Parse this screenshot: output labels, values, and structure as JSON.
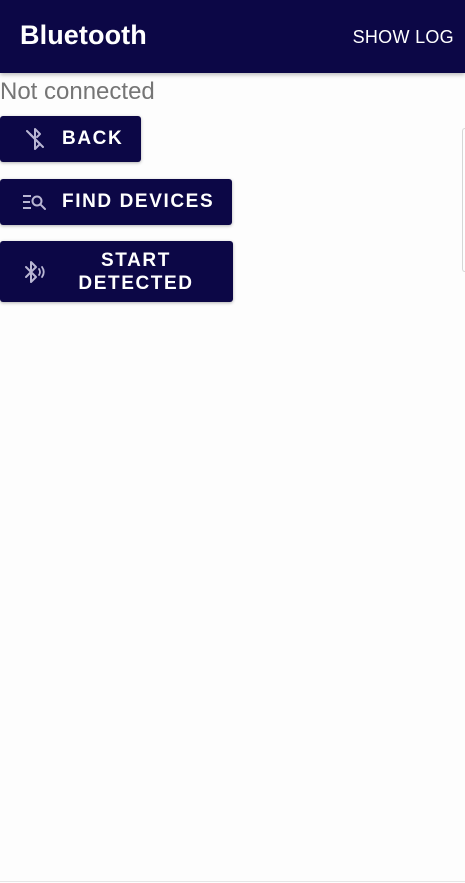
{
  "appbar": {
    "title": "Bluetooth",
    "action_label": "SHOW LOG"
  },
  "status": {
    "text": "Not connected"
  },
  "buttons": {
    "back": {
      "label": "BACK",
      "icon": "bluetooth-disabled-icon"
    },
    "find": {
      "label": "FIND DEVICES",
      "icon": "manage-search-icon"
    },
    "start": {
      "label_line1": "START",
      "label_line2": "DETECTED",
      "icon": "bluetooth-searching-icon"
    }
  },
  "colors": {
    "primary": "#0c0746",
    "on_primary": "#ffffff",
    "status_text": "#757575",
    "background": "#fdfdfd",
    "icon_tint": "#b9b6d3"
  }
}
